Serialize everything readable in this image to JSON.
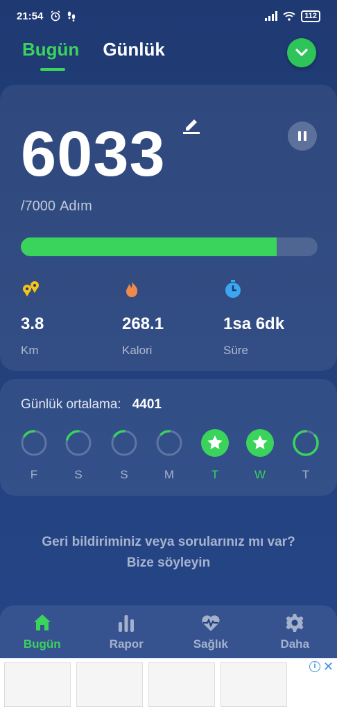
{
  "status_bar": {
    "time": "21:54",
    "battery": "112"
  },
  "tabs": [
    {
      "label": "Bugün",
      "active": true
    },
    {
      "label": "Günlük",
      "active": false
    }
  ],
  "main": {
    "steps": "6033",
    "goal_text": "/7000",
    "goal_unit": "Adım",
    "progress_fraction": 0.862,
    "stats": [
      {
        "icon": "route-icon",
        "value": "3.8",
        "label": "Km",
        "color": "#f5c518"
      },
      {
        "icon": "flame-icon",
        "value": "268.1",
        "label": "Kalori",
        "color": "#f08a4b"
      },
      {
        "icon": "clock-icon",
        "value": "1sa 6dk",
        "label": "Süre",
        "color": "#3aa7f0"
      }
    ]
  },
  "weekly": {
    "avg_label": "Günlük ortalama:",
    "avg_value": "4401",
    "days": [
      {
        "label": "F",
        "progress": 0.15,
        "achieved": false,
        "highlight": false
      },
      {
        "label": "S",
        "progress": 0.2,
        "achieved": false,
        "highlight": false
      },
      {
        "label": "S",
        "progress": 0.15,
        "achieved": false,
        "highlight": false
      },
      {
        "label": "M",
        "progress": 0.12,
        "achieved": false,
        "highlight": false
      },
      {
        "label": "T",
        "progress": 1.0,
        "achieved": true,
        "highlight": true
      },
      {
        "label": "W",
        "progress": 1.0,
        "achieved": true,
        "highlight": true
      },
      {
        "label": "T",
        "progress": 0.86,
        "achieved": false,
        "highlight": false
      }
    ]
  },
  "feedback": {
    "line1": "Geri bildiriminiz veya sorularınız mı var?",
    "line2": "Bize söyleyin"
  },
  "nav": [
    {
      "label": "Bugün",
      "icon": "home-icon",
      "active": true
    },
    {
      "label": "Rapor",
      "icon": "bar-chart-icon",
      "active": false
    },
    {
      "label": "Sağlık",
      "icon": "heart-pulse-icon",
      "active": false
    },
    {
      "label": "Daha",
      "icon": "gear-icon",
      "active": false
    }
  ],
  "colors": {
    "accent": "#3ad35c",
    "background": "#22407a"
  }
}
